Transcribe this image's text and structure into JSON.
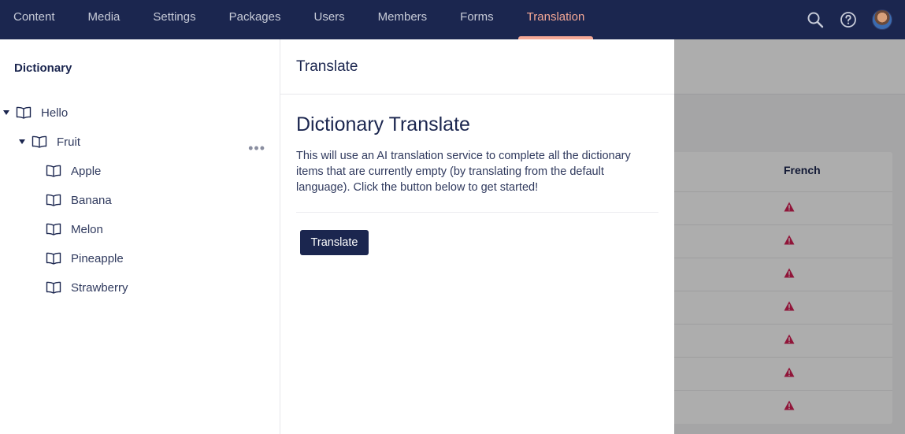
{
  "topnav": {
    "items": [
      {
        "label": "Content",
        "active": false
      },
      {
        "label": "Media",
        "active": false
      },
      {
        "label": "Settings",
        "active": false
      },
      {
        "label": "Packages",
        "active": false
      },
      {
        "label": "Users",
        "active": false
      },
      {
        "label": "Members",
        "active": false
      },
      {
        "label": "Forms",
        "active": false
      },
      {
        "label": "Translation",
        "active": true
      }
    ],
    "icons": [
      "search-icon",
      "help-icon",
      "avatar"
    ]
  },
  "sidebar": {
    "title": "Dictionary",
    "tree": [
      {
        "label": "Hello",
        "level": 0,
        "expanded": true
      },
      {
        "label": "Fruit",
        "level": 1,
        "expanded": true
      },
      {
        "label": "Apple",
        "level": 2
      },
      {
        "label": "Banana",
        "level": 2
      },
      {
        "label": "Melon",
        "level": 2
      },
      {
        "label": "Pineapple",
        "level": 2
      },
      {
        "label": "Strawberry",
        "level": 2
      }
    ]
  },
  "background": {
    "column_header": "French",
    "warning_icon_count": 7
  },
  "dialog": {
    "title": "Translate",
    "heading": "Dictionary Translate",
    "description": "This will use an AI translation service to complete all the dictionary items that are currently empty (by translating from the default language). Click the button below to get started!",
    "button_label": "Translate"
  },
  "colors": {
    "topbar": "#1b264f",
    "active_nav": "#f5a896",
    "button": "#1b264f",
    "warning": "#d42054"
  }
}
